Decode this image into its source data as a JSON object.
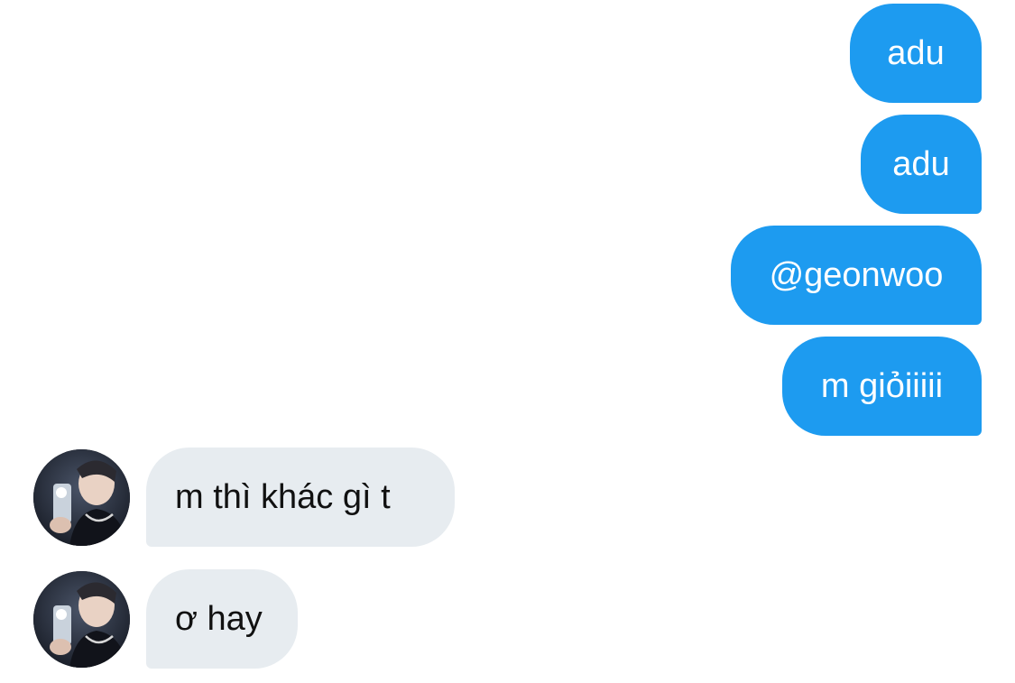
{
  "conversation": {
    "sent": [
      {
        "text": "adu"
      },
      {
        "text": "adu"
      },
      {
        "text": "@geonwoo"
      },
      {
        "text": "m giỏiiiii"
      }
    ],
    "received": [
      {
        "text": "m thì khác gì t",
        "avatar_icon": "user-avatar-photo"
      },
      {
        "text": "ơ hay",
        "avatar_icon": "user-avatar-photo"
      }
    ]
  },
  "colors": {
    "sent_bubble": "#1d9bf0",
    "received_bubble": "#e7ecf0",
    "sent_text": "#ffffff",
    "received_text": "#111111",
    "background": "#ffffff"
  }
}
